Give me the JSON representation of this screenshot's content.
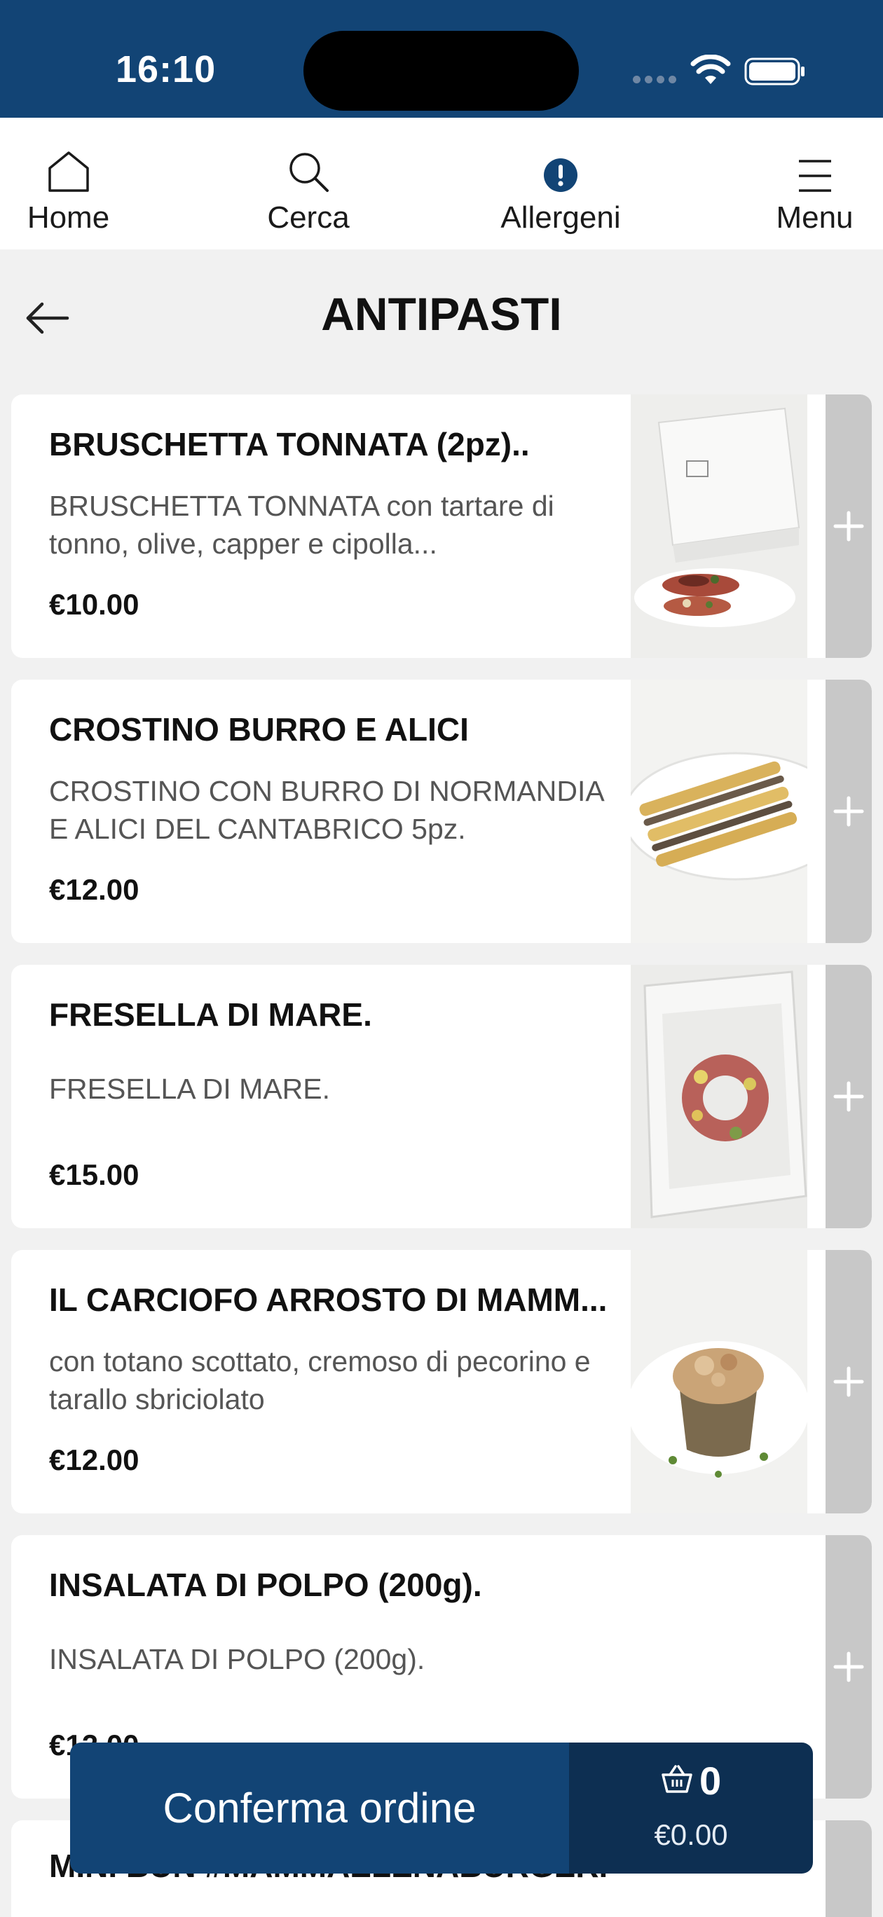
{
  "status_bar": {
    "time": "16:10"
  },
  "nav": {
    "home": "Home",
    "search": "Cerca",
    "allergens": "Allergeni",
    "menu": "Menu"
  },
  "page": {
    "title": "ANTIPASTI"
  },
  "products": [
    {
      "name": "BRUSCHETTA TONNATA (2pz)..",
      "description": "BRUSCHETTA TONNATA con tartare di tonno, olive, capper e cipolla...",
      "price": "€10.00"
    },
    {
      "name": "CROSTINO BURRO E ALICI",
      "description": "CROSTINO CON BURRO DI NORMANDIA E ALICI DEL CANTABRICO 5pz.",
      "price": "€12.00"
    },
    {
      "name": "FRESELLA DI MARE.",
      "description": "FRESELLA DI MARE.",
      "price": "€15.00"
    },
    {
      "name": "IL CARCIOFO ARROSTO DI MAMM...",
      "description": "con totano scottato, cremoso di pecorino e tarallo sbriciolato",
      "price": "€12.00"
    },
    {
      "name": "INSALATA DI POLPO (200g).",
      "description": "INSALATA DI POLPO (200g).",
      "price": "€12.00"
    },
    {
      "name": "MINI BUN #MAMMAELENABURGER."
    }
  ],
  "order": {
    "confirm_label": "Conferma ordine",
    "item_count": "0",
    "total": "€0.00"
  },
  "colors": {
    "brand_blue": "#124475",
    "dark_blue": "#0d2f52",
    "add_button_gray": "#c8c8c8"
  }
}
